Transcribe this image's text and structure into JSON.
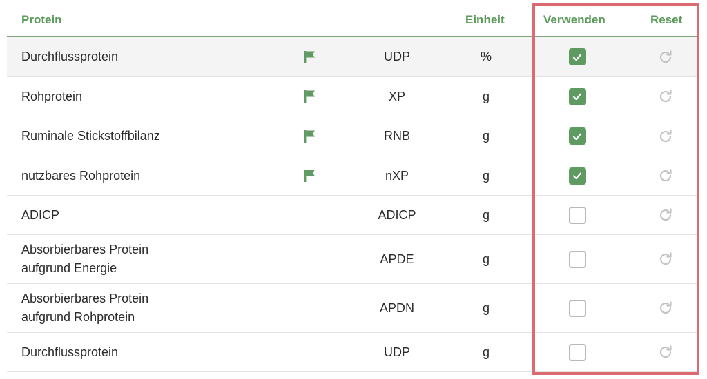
{
  "header": {
    "protein": "Protein",
    "einheit": "Einheit",
    "verwenden": "Verwenden",
    "reset": "Reset"
  },
  "colors": {
    "accent": "#5a9a5a",
    "checkbox_checked": "#5f9a63",
    "highlight_border": "#dc6a72",
    "row_shaded": "#f4f4f4"
  },
  "rows": [
    {
      "name": "Durchflussprotein",
      "name2": "",
      "flag": true,
      "abbr": "UDP",
      "unit": "%",
      "checked": true
    },
    {
      "name": "Rohprotein",
      "name2": "",
      "flag": true,
      "abbr": "XP",
      "unit": "g",
      "checked": true
    },
    {
      "name": "Ruminale Stickstoffbilanz",
      "name2": "",
      "flag": true,
      "abbr": "RNB",
      "unit": "g",
      "checked": true
    },
    {
      "name": "nutzbares Rohprotein",
      "name2": "",
      "flag": true,
      "abbr": "nXP",
      "unit": "g",
      "checked": true
    },
    {
      "name": "ADICP",
      "name2": "",
      "flag": false,
      "abbr": "ADICP",
      "unit": "g",
      "checked": false
    },
    {
      "name": "Absorbierbares Protein",
      "name2": "aufgrund Energie",
      "flag": false,
      "abbr": "APDE",
      "unit": "g",
      "checked": false
    },
    {
      "name": "Absorbierbares Protein",
      "name2": "aufgrund Rohprotein",
      "flag": false,
      "abbr": "APDN",
      "unit": "g",
      "checked": false
    },
    {
      "name": "Durchflussprotein",
      "name2": "",
      "flag": false,
      "abbr": "UDP",
      "unit": "g",
      "checked": false
    }
  ],
  "icons": {
    "flag": "flag-icon",
    "check": "checkmark-icon",
    "reset": "reset-icon"
  }
}
